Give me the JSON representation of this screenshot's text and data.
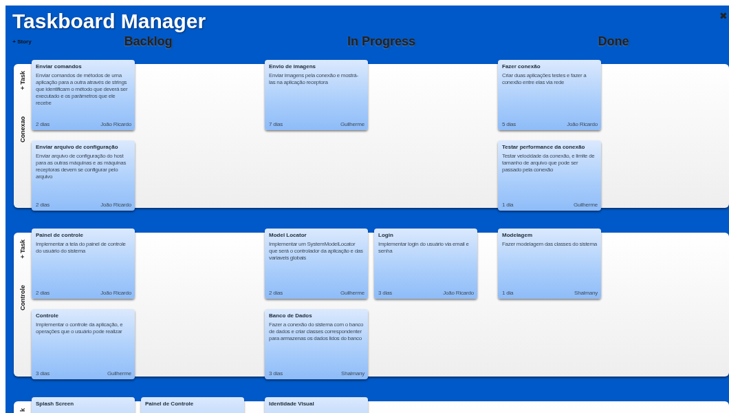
{
  "app": {
    "title": "Taskboard Manager",
    "add_story": "+ Story",
    "close": "✖"
  },
  "columns": [
    {
      "title": "Backlog"
    },
    {
      "title": "In Progress"
    },
    {
      "title": "Done"
    }
  ],
  "stories": [
    {
      "name": "Conexao",
      "add_task": "+ Task",
      "cells": [
        [
          [
            {
              "title": "Enviar comandos",
              "description": "Enviar comandos de métodos de uma aplicação para a outra através de strings que identificam o método que deverá ser executado e os parâmetros que ele recebe",
              "estimate": "2 dias",
              "owner": "João Ricardo"
            }
          ],
          [
            {
              "title": "Enviar arquivo de configuração",
              "description": "Enviar arquivo de configuração do host para as outras máquinas e as máquinas receptoras devem se configurar pelo arquivo",
              "estimate": "2 dias",
              "owner": "João Ricardo"
            }
          ]
        ],
        [
          [
            {
              "title": "Envio de imagens",
              "description": "Enviar imagens pela conexão e mostrá-las na aplicação receptora",
              "estimate": "7 dias",
              "owner": "Guilherme"
            }
          ]
        ],
        [
          [
            {
              "title": "Fazer conexão",
              "description": "Criar duas aplicações testes e fazer a conexão entre elas via rede",
              "estimate": "5 dias",
              "owner": "João Ricardo"
            }
          ],
          [
            {
              "title": "Testar performance da conexão",
              "description": "Testar velocidade da conexão, e limite de tamanho de arquivo que pode ser passado pela conexão",
              "estimate": "1 dia",
              "owner": "Guilherme"
            }
          ]
        ]
      ]
    },
    {
      "name": "Controle",
      "add_task": "+ Task",
      "cells": [
        [
          [
            {
              "title": "Painel de controle",
              "description": "Implementar a tela do painel de controle do usuário do sistema",
              "estimate": "2 dias",
              "owner": "João Ricardo"
            }
          ],
          [
            {
              "title": "Controle",
              "description": "Implementar o controle da aplicação, e operações que o usuário pode realizar",
              "estimate": "3 dias",
              "owner": "Guilherme"
            }
          ]
        ],
        [
          [
            {
              "title": "Model Locator",
              "description": "Implementar um SystemModelLocator que será o controlador da aplicação e das variaveis globais",
              "estimate": "2 dias",
              "owner": "Guilherme"
            },
            {
              "title": "Login",
              "description": "Implementar login do usuário via email e senha",
              "estimate": "3 dias",
              "owner": "João Ricardo"
            }
          ],
          [
            {
              "title": "Banco de Dados",
              "description": "Fazer a conexão do sistema com o banco de dados e criar classes correspondenter para armazenas os dados lidos do banco",
              "estimate": "3 dias",
              "owner": "Shalmany"
            }
          ]
        ],
        [
          [
            {
              "title": "Modelagem",
              "description": "Fazer modelagem das classes do sistema",
              "estimate": "1 dia",
              "owner": "Shalmany"
            }
          ]
        ]
      ]
    },
    {
      "add_task": "k",
      "cells": [
        [
          [
            {
              "title": "Splash Screen"
            },
            {
              "title": "Painel de Controle"
            }
          ]
        ],
        [
          [
            {
              "title": "Identidade Visual"
            }
          ]
        ],
        []
      ]
    }
  ]
}
